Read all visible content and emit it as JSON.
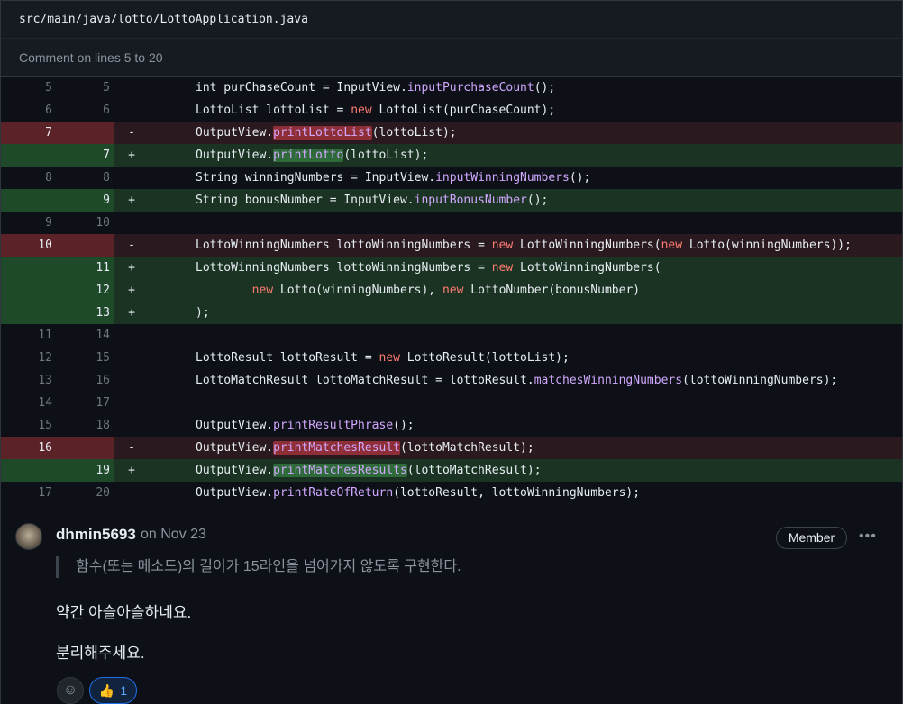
{
  "file": {
    "path": "src/main/java/lotto/LottoApplication.java"
  },
  "comment_range": "Comment on lines 5 to 20",
  "diff_lines": [
    {
      "type": "ctx",
      "old": "5",
      "new": "5",
      "marker": "",
      "segments": [
        {
          "t": "int purChaseCount = InputView."
        },
        {
          "t": "inputPurchaseCount",
          "c": "fn"
        },
        {
          "t": "();"
        }
      ]
    },
    {
      "type": "ctx",
      "old": "6",
      "new": "6",
      "marker": "",
      "segments": [
        {
          "t": "LottoList lottoList = "
        },
        {
          "t": "new",
          "c": "kw"
        },
        {
          "t": " LottoList(purChaseCount);"
        }
      ]
    },
    {
      "type": "del",
      "old": "7",
      "new": "",
      "marker": "-",
      "segments": [
        {
          "t": "OutputView."
        },
        {
          "t": "printLottoList",
          "c": "fn",
          "h": "del"
        },
        {
          "t": "(lottoList);"
        }
      ]
    },
    {
      "type": "add",
      "old": "",
      "new": "7",
      "marker": "+",
      "segments": [
        {
          "t": "OutputView."
        },
        {
          "t": "printLotto",
          "c": "fn",
          "h": "add"
        },
        {
          "t": "(lottoList);"
        }
      ]
    },
    {
      "type": "ctx",
      "old": "8",
      "new": "8",
      "marker": "",
      "segments": [
        {
          "t": "String winningNumbers = InputView."
        },
        {
          "t": "inputWinningNumbers",
          "c": "fn"
        },
        {
          "t": "();"
        }
      ]
    },
    {
      "type": "add",
      "old": "",
      "new": "9",
      "marker": "+",
      "segments": [
        {
          "t": "String bonusNumber = InputView."
        },
        {
          "t": "inputBonusNumber",
          "c": "fn"
        },
        {
          "t": "();"
        }
      ]
    },
    {
      "type": "ctx",
      "old": "9",
      "new": "10",
      "marker": "",
      "segments": [
        {
          "t": ""
        }
      ]
    },
    {
      "type": "del",
      "old": "10",
      "new": "",
      "marker": "-",
      "segments": [
        {
          "t": "LottoWinningNumbers lottoWinningNumbers = "
        },
        {
          "t": "new",
          "c": "kw"
        },
        {
          "t": " LottoWinningNumbers("
        },
        {
          "t": "new",
          "c": "kw"
        },
        {
          "t": " Lotto(winningNumbers));"
        }
      ]
    },
    {
      "type": "add",
      "old": "",
      "new": "11",
      "marker": "+",
      "segments": [
        {
          "t": "LottoWinningNumbers lottoWinningNumbers = "
        },
        {
          "t": "new",
          "c": "kw"
        },
        {
          "t": " LottoWinningNumbers("
        }
      ]
    },
    {
      "type": "add",
      "old": "",
      "new": "12",
      "marker": "+",
      "segments": [
        {
          "t": "        "
        },
        {
          "t": "new",
          "c": "kw"
        },
        {
          "t": " Lotto(winningNumbers), "
        },
        {
          "t": "new",
          "c": "kw"
        },
        {
          "t": " LottoNumber(bonusNumber)"
        }
      ]
    },
    {
      "type": "add",
      "old": "",
      "new": "13",
      "marker": "+",
      "segments": [
        {
          "t": ");"
        }
      ]
    },
    {
      "type": "ctx",
      "old": "11",
      "new": "14",
      "marker": "",
      "segments": [
        {
          "t": ""
        }
      ]
    },
    {
      "type": "ctx",
      "old": "12",
      "new": "15",
      "marker": "",
      "segments": [
        {
          "t": "LottoResult lottoResult = "
        },
        {
          "t": "new",
          "c": "kw"
        },
        {
          "t": " LottoResult(lottoList);"
        }
      ]
    },
    {
      "type": "ctx",
      "old": "13",
      "new": "16",
      "marker": "",
      "segments": [
        {
          "t": "LottoMatchResult lottoMatchResult = lottoResult."
        },
        {
          "t": "matchesWinningNumbers",
          "c": "fn"
        },
        {
          "t": "(lottoWinningNumbers);"
        }
      ]
    },
    {
      "type": "ctx",
      "old": "14",
      "new": "17",
      "marker": "",
      "segments": [
        {
          "t": ""
        }
      ]
    },
    {
      "type": "ctx",
      "old": "15",
      "new": "18",
      "marker": "",
      "segments": [
        {
          "t": "OutputView."
        },
        {
          "t": "printResultPhrase",
          "c": "fn"
        },
        {
          "t": "();"
        }
      ]
    },
    {
      "type": "del",
      "old": "16",
      "new": "",
      "marker": "-",
      "segments": [
        {
          "t": "OutputView."
        },
        {
          "t": "printMatchesResult",
          "c": "fn",
          "h": "del"
        },
        {
          "t": "(lottoMatchResult);"
        }
      ]
    },
    {
      "type": "add",
      "old": "",
      "new": "19",
      "marker": "+",
      "segments": [
        {
          "t": "OutputView."
        },
        {
          "t": "printMatchesResults",
          "c": "fn",
          "h": "add"
        },
        {
          "t": "(lottoMatchResult);"
        }
      ]
    },
    {
      "type": "ctx",
      "old": "17",
      "new": "20",
      "marker": "",
      "segments": [
        {
          "t": "OutputView."
        },
        {
          "t": "printRateOfReturn",
          "c": "fn"
        },
        {
          "t": "(lottoResult, lottoWinningNumbers);"
        }
      ]
    }
  ],
  "comment": {
    "author": "dhmin5693",
    "date": "on Nov 23",
    "role_badge": "Member",
    "menu_icon": "kebab-horizontal-icon",
    "quote": "함수(또는 메소드)의 길이가 15라인을 넘어가지 않도록 구현한다.",
    "paragraphs": [
      "약간 아슬아슬하네요.",
      "분리해주세요."
    ],
    "reactions": {
      "emoji_button_icon": "smiley-icon",
      "thumbs_up_icon": "thumbs-up-icon",
      "thumbs_up_count": "1"
    }
  }
}
